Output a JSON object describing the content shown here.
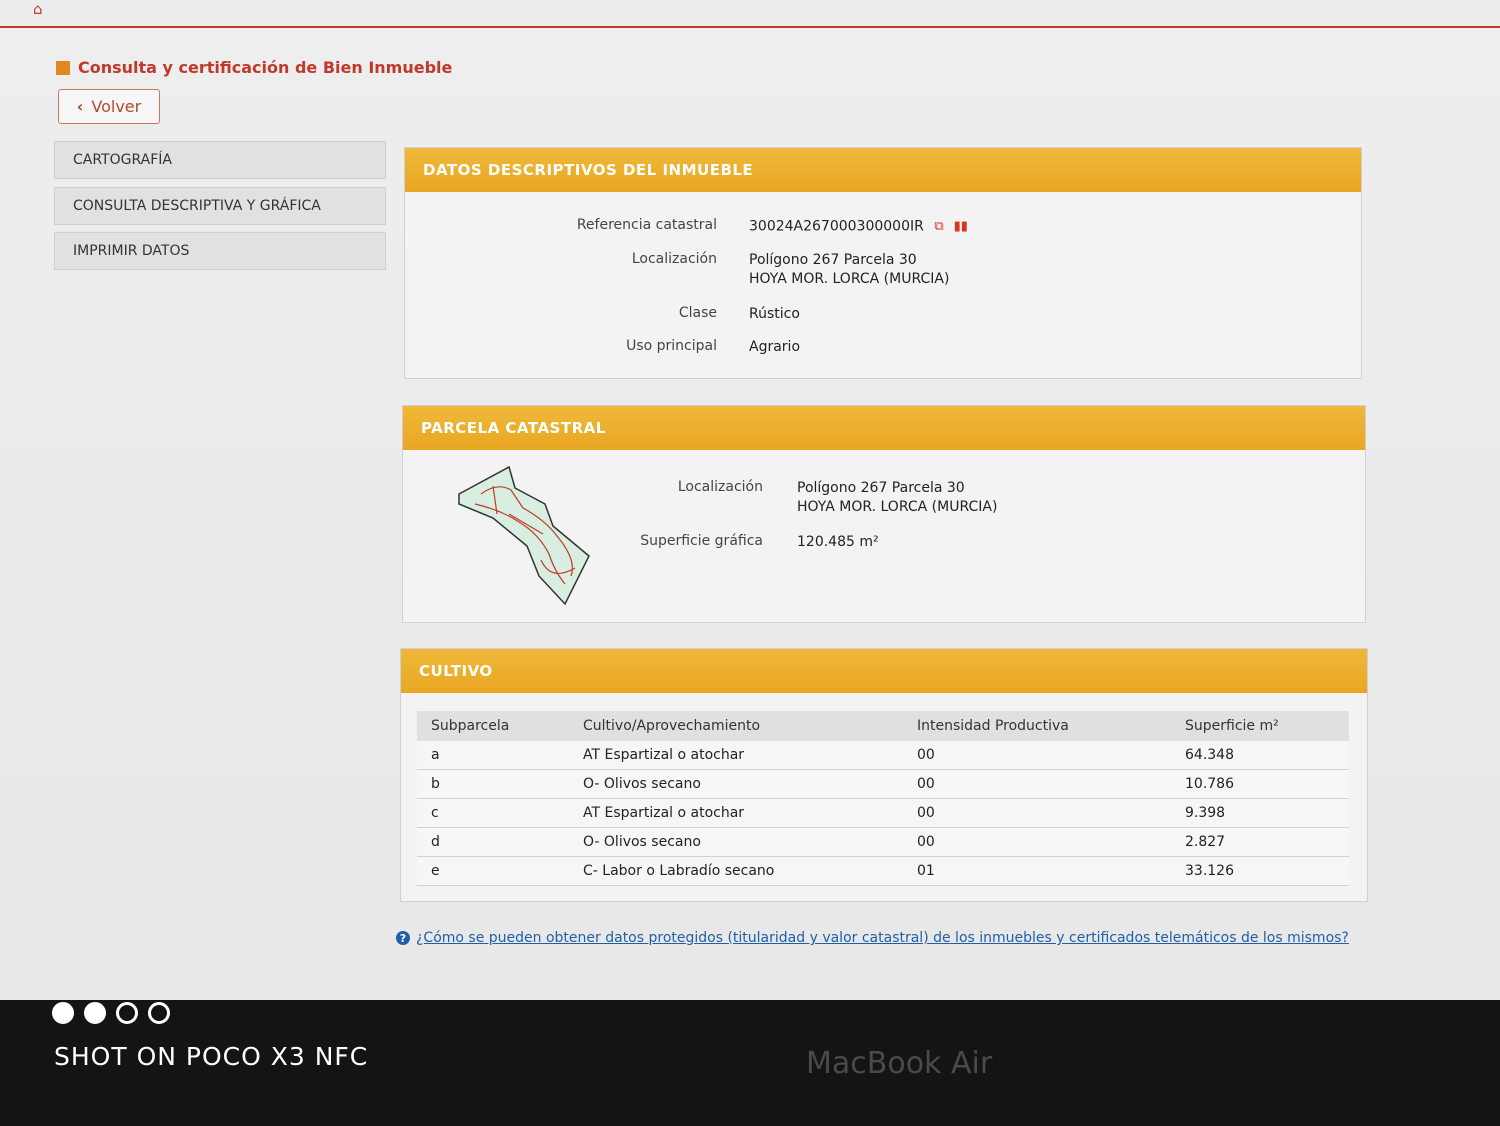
{
  "header": {
    "home_icon": "home-icon",
    "title": "Consulta y certificación de Bien Inmueble",
    "back_label": "Volver"
  },
  "sidebar": {
    "items": [
      {
        "label": "CARTOGRAFÍA"
      },
      {
        "label": "CONSULTA DESCRIPTIVA Y GRÁFICA"
      },
      {
        "label": "IMPRIMIR DATOS"
      }
    ]
  },
  "datos": {
    "title": "DATOS DESCRIPTIVOS DEL INMUEBLE",
    "ref_label": "Referencia catastral",
    "ref_value": "30024A267000300000IR",
    "loc_label": "Localización",
    "loc_line1": "Polígono 267 Parcela 30",
    "loc_line2": "HOYA MOR. LORCA (MURCIA)",
    "clase_label": "Clase",
    "clase_value": "Rústico",
    "uso_label": "Uso principal",
    "uso_value": "Agrario"
  },
  "parcela": {
    "title": "PARCELA CATASTRAL",
    "loc_label": "Localización",
    "loc_line1": "Polígono 267 Parcela 30",
    "loc_line2": "HOYA MOR. LORCA (MURCIA)",
    "sup_label": "Superficie gráfica",
    "sup_value": "120.485 m²"
  },
  "cultivo": {
    "title": "CULTIVO",
    "columns": [
      "Subparcela",
      "Cultivo/Aprovechamiento",
      "Intensidad Productiva",
      "Superficie m²"
    ],
    "rows": [
      [
        "a",
        "AT Espartizal o atochar",
        "00",
        "64.348"
      ],
      [
        "b",
        "O- Olivos secano",
        "00",
        "10.786"
      ],
      [
        "c",
        "AT Espartizal o atochar",
        "00",
        "9.398"
      ],
      [
        "d",
        "O- Olivos secano",
        "00",
        "2.827"
      ],
      [
        "e",
        "C- Labor o Labradío secano",
        "01",
        "33.126"
      ]
    ]
  },
  "help": {
    "icon": "question-circle-icon",
    "link_text": "¿Cómo se pueden obtener datos protegidos (titularidad y valor catastral) de los inmuebles y certificados telemáticos de los mismos?"
  },
  "colors": {
    "accent": "#e8a622",
    "title_red": "#c0392b",
    "link_blue": "#1f5fa8"
  },
  "photo_overlay": {
    "watermark": "SHOT ON POCO X3 NFC",
    "laptop_label": "MacBook Air"
  }
}
